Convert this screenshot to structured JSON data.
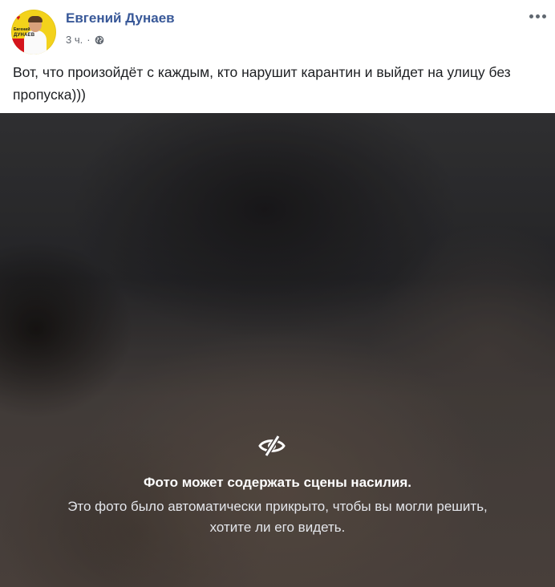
{
  "post": {
    "author": "Евгений Дунаев",
    "time": "3 ч.",
    "separator": "·",
    "privacy_icon": "globe-icon",
    "more_icon": "more-options-icon",
    "text": "Вот, что произойдёт с каждым, кто нарушит карантин и выйдет на улицу без пропуска)))"
  },
  "avatar": {
    "line1": "Евгений",
    "line2": "ДУНАЕВ"
  },
  "media": {
    "icon": "eye-slash-icon",
    "warning_title": "Фото может содержать сцены насилия.",
    "warning_description": "Это фото было автоматически прикрыто, чтобы вы могли решить, хотите ли его видеть."
  },
  "colors": {
    "author_link": "#385898",
    "meta_text": "#616770",
    "body_text": "#1c1e21",
    "avatar_bg": "#f3d21b"
  }
}
